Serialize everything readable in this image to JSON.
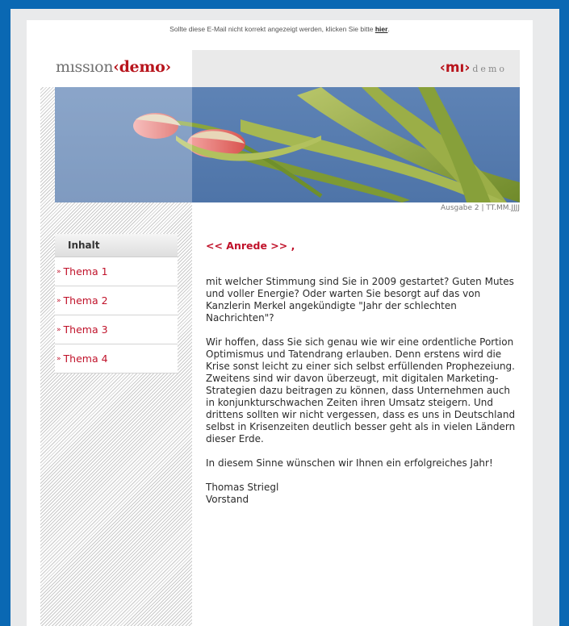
{
  "preheader": {
    "text": "Sollte diese E-Mail nicht korrekt angezeigt werden, klicken Sie bitte",
    "link": "hier",
    "end": "."
  },
  "header": {
    "logo": {
      "part1": "mıssıon",
      "bracket_open": "‹",
      "part2": "demo",
      "bracket_close": "›"
    },
    "mark": {
      "mi": "‹mı›",
      "demo": "demo"
    }
  },
  "edition": "Ausgabe 2 | TT.MM.JJJJ",
  "nav": {
    "title": "Inhalt",
    "items": [
      {
        "label": "Thema 1"
      },
      {
        "label": "Thema 2"
      },
      {
        "label": "Thema 3"
      },
      {
        "label": "Thema 4"
      }
    ]
  },
  "content": {
    "salutation": "<< Anrede >> ,",
    "paragraphs": [
      "mit welcher Stimmung sind Sie in 2009 gestartet? Guten Mutes und voller Energie? Oder warten Sie besorgt auf das von Kanzlerin Merkel angekündigte \"Jahr der schlechten Nachrichten\"?",
      "Wir hoffen, dass Sie sich genau wie wir eine ordentliche Portion Optimismus und Tatendrang erlauben. Denn erstens wird die Krise sonst leicht zu einer sich selbst erfüllenden Prophezeiung. Zweitens sind wir davon überzeugt, mit digitalen Marketing-Strategien dazu beitragen zu können, dass Unternehmen auch in konjunkturschwachen Zeiten ihren Umsatz steigern. Und drittens sollten wir nicht vergessen, dass es uns in Deutschland selbst in Krisenzeiten deutlich besser geht als in vielen Ländern dieser Erde.",
      "In diesem Sinne wünschen wir Ihnen ein erfolgreiches Jahr!"
    ],
    "signature_name": "Thomas Striegl",
    "signature_title": "Vorstand"
  },
  "colors": {
    "frame": "#0a68b3",
    "accent": "#c0122a",
    "sky": "#4e74a8"
  },
  "icons": {
    "nav_bullet": "»"
  }
}
